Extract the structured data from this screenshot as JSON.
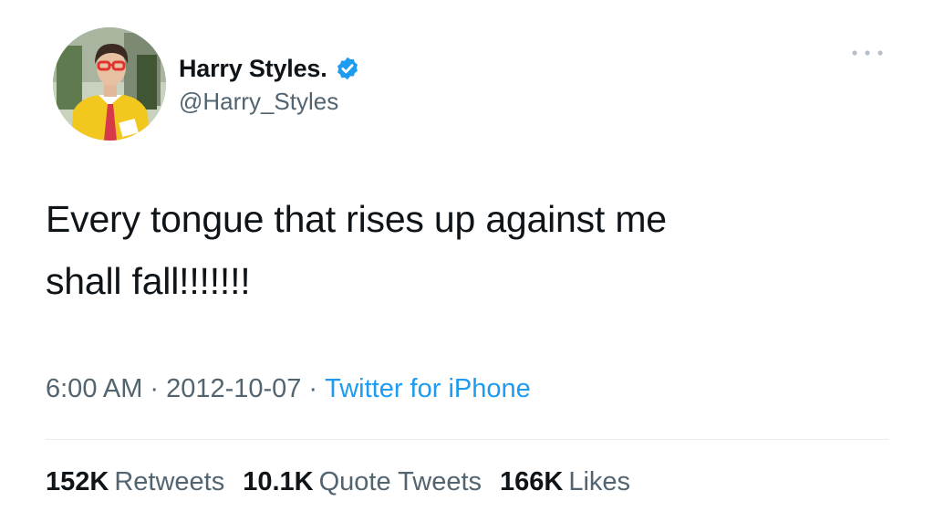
{
  "author": {
    "display_name": "Harry Styles.",
    "handle": "@Harry_Styles",
    "verified": true,
    "avatar_icon": "profile-photo",
    "verified_icon": "verified-badge-icon",
    "verified_color": "#1d9bf0"
  },
  "menu": {
    "icon": "more-options-icon"
  },
  "tweet": {
    "text": "Every tongue that rises up against me\nshall fall!!!!!!!"
  },
  "meta": {
    "time": "6:00 AM",
    "separator": "·",
    "date": "2012-10-07",
    "source": "Twitter for iPhone",
    "source_color": "#1d9bf0"
  },
  "stats": {
    "retweets_count": "152K",
    "retweets_label": "Retweets",
    "quotes_count": "10.1K",
    "quotes_label": "Quote Tweets",
    "likes_count": "166K",
    "likes_label": "Likes"
  }
}
